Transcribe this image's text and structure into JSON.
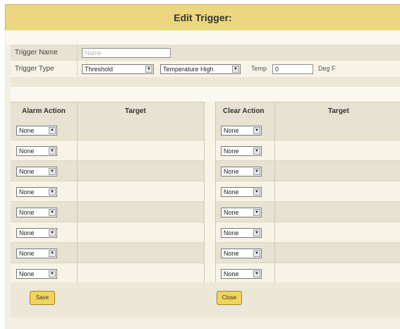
{
  "title": "Edit Trigger:",
  "form": {
    "name_label": "Trigger Name",
    "name_placeholder": "Name",
    "type_label": "Trigger Type",
    "type_value": "Threshold",
    "condition_value": "Temperature High",
    "temp_label": "Temp",
    "temp_value": "0",
    "unit_label": "Deg F"
  },
  "table": {
    "headers": {
      "alarm_action": "Alarm Action",
      "alarm_target": "Target",
      "clear_action": "Clear Action",
      "clear_target": "Target"
    },
    "rows": [
      {
        "alarm": "None",
        "clear": "None"
      },
      {
        "alarm": "None",
        "clear": "None"
      },
      {
        "alarm": "None",
        "clear": "None"
      },
      {
        "alarm": "None",
        "clear": "None"
      },
      {
        "alarm": "None",
        "clear": "None"
      },
      {
        "alarm": "None",
        "clear": "None"
      },
      {
        "alarm": "None",
        "clear": "None"
      },
      {
        "alarm": "None",
        "clear": "None"
      }
    ]
  },
  "buttons": {
    "save": "Save",
    "close": "Close"
  },
  "colors": {
    "title_bar": "#ecd780",
    "button": "#f0d45c",
    "panel": "#f3efe2"
  }
}
